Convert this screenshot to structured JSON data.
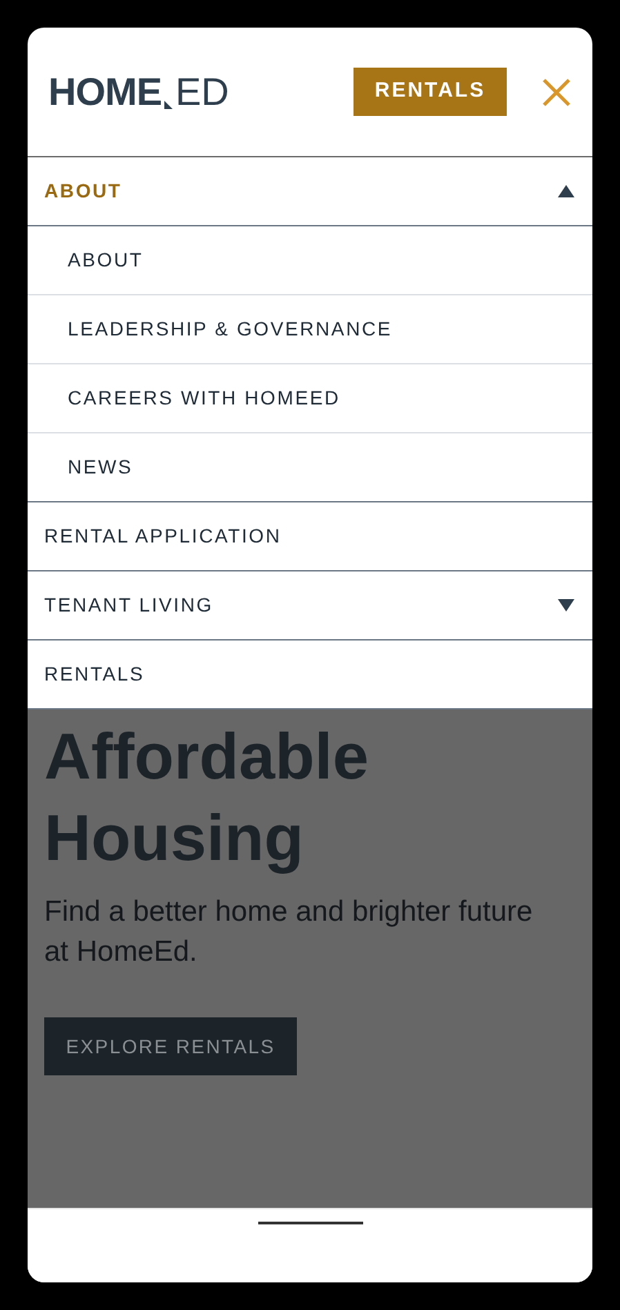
{
  "header": {
    "logo": {
      "bold": "HOME",
      "light": "ED"
    },
    "cta": "RENTALS"
  },
  "menu": [
    {
      "label": "ABOUT",
      "kind": "folder",
      "expanded": true,
      "children": [
        {
          "label": "ABOUT"
        },
        {
          "label": "LEADERSHIP & GOVERNANCE"
        },
        {
          "label": "CAREERS WITH HOMEED"
        },
        {
          "label": "NEWS"
        }
      ]
    },
    {
      "label": "RENTAL APPLICATION",
      "kind": "link"
    },
    {
      "label": "TENANT LIVING",
      "kind": "folder",
      "expanded": false
    },
    {
      "label": "RENTALS",
      "kind": "link"
    }
  ],
  "hero": {
    "title_lines": [
      "Affordable",
      "Housing"
    ],
    "subtitle": "Find a better home and brighter future at HomeEd.",
    "button": "EXPLORE RENTALS"
  }
}
